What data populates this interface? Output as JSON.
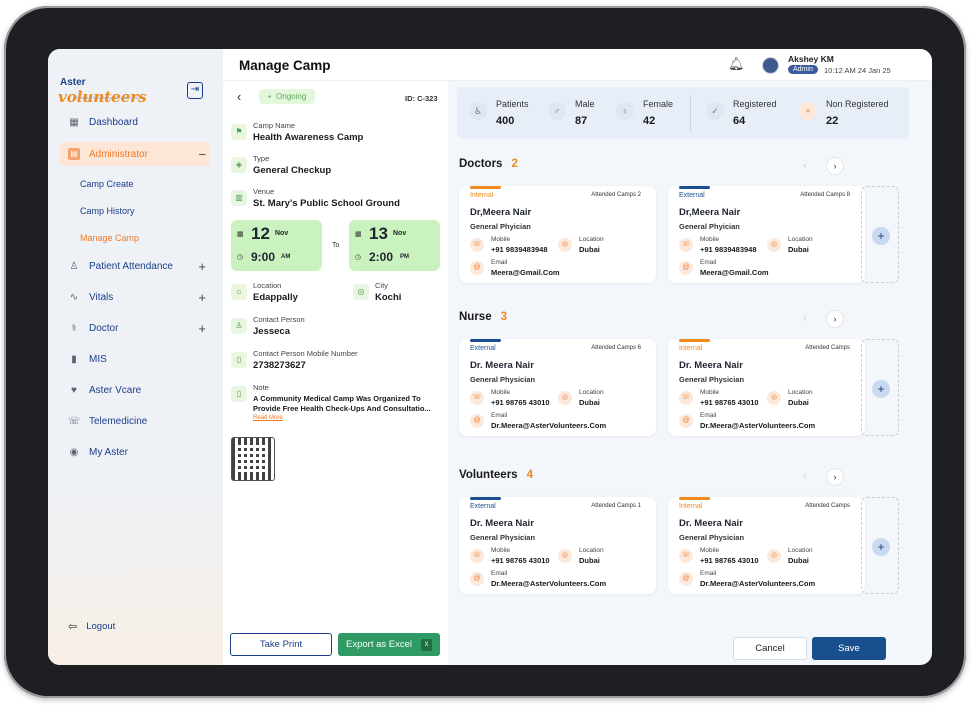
{
  "sidebar": {
    "logo_top": "Aster",
    "logo_main": "volunteers",
    "logo_tag": "Mobilising Volunteers for Community",
    "items": [
      {
        "label": "Dashboard",
        "icon": "grid-icon"
      },
      {
        "label": "Administrator",
        "icon": "admin-icon",
        "expanded": true
      },
      {
        "label": "Patient Attendance",
        "icon": "person-icon"
      },
      {
        "label": "Vitals",
        "icon": "pulse-icon"
      },
      {
        "label": "Doctor",
        "icon": "doctor-icon"
      },
      {
        "label": "MIS",
        "icon": "file-icon"
      },
      {
        "label": "Aster Vcare",
        "icon": "heart-icon"
      },
      {
        "label": "Telemedicine",
        "icon": "phone-icon"
      },
      {
        "label": "My Aster",
        "icon": "user-circle-icon"
      }
    ],
    "sub_items": [
      "Camp Create",
      "Camp History",
      "Manage Camp"
    ],
    "logout": "Logout"
  },
  "header": {
    "title": "Manage Camp",
    "user_name": "Akshey KM",
    "role": "Admin",
    "datetime": "10:12 AM 24 Jan 25"
  },
  "detail": {
    "status": "Ongoing",
    "camp_id": "ID: C-323",
    "camp_name_label": "Camp Name",
    "camp_name": "Health Awareness Camp",
    "type_label": "Type",
    "type": "General Checkup",
    "venue_label": "Venue",
    "venue": "St. Mary's Public School Ground",
    "start_day": "12",
    "start_month": "Nov",
    "start_time": "9:00",
    "start_ampm": "AM",
    "to": "To",
    "end_day": "13",
    "end_month": "Nov",
    "end_time": "2:00",
    "end_ampm": "PM",
    "location_label": "Location",
    "location": "Edappally",
    "city_label": "City",
    "city": "Kochi",
    "contact_label": "Contact Person",
    "contact": "Jesseca",
    "mobile_label": "Contact Person Mobile Number",
    "mobile": "2738273627",
    "note_label": "Note",
    "note": "A Community Medical Camp Was Organized To Provide Free Health Check-Ups And Consultatio...",
    "read_more": "Read More",
    "print_btn": "Take Print",
    "excel_btn": "Export as Excel"
  },
  "stats": [
    {
      "label": "Patients",
      "value": "400",
      "icon": "patients-icon"
    },
    {
      "label": "Male",
      "value": "87",
      "icon": "male-icon"
    },
    {
      "label": "Female",
      "value": "42",
      "icon": "female-icon"
    },
    {
      "label": "Registered",
      "value": "64",
      "icon": "registered-icon"
    },
    {
      "label": "Non Registered",
      "value": "22",
      "icon": "non-registered-icon"
    }
  ],
  "sections": [
    {
      "title": "Doctors",
      "count": "2",
      "cards": [
        {
          "type": "Internal",
          "attended": "Attended Camps 2",
          "name": "Dr,Meera Nair",
          "spec": "General Phyician",
          "mobile_label": "Mobile",
          "mobile": "+91 9839483948",
          "location_label": "Location",
          "location": "Dubai",
          "email_label": "Email",
          "email": "Meera@Gmail.Com"
        },
        {
          "type": "External",
          "attended": "Attended Camps 8",
          "name": "Dr,Meera Nair",
          "spec": "General Phyician",
          "mobile_label": "Mobile",
          "mobile": "+91 9839483948",
          "location_label": "Location",
          "location": "Dubai",
          "email_label": "Email",
          "email": "Meera@Gmail.Com"
        }
      ]
    },
    {
      "title": "Nurse",
      "count": "3",
      "cards": [
        {
          "type": "External",
          "attended": "Attended Camps 6",
          "name": "Dr. Meera Nair",
          "spec": "General Physician",
          "mobile_label": "Mobile",
          "mobile": "+91 98765 43010",
          "location_label": "Location",
          "location": "Dubai",
          "email_label": "Email",
          "email": "Dr.Meera@AsterVolunteers.Com"
        },
        {
          "type": "Internal",
          "attended": "Attended Camps",
          "name": "Dr. Meera Nair",
          "spec": "General Physician",
          "mobile_label": "Mobile",
          "mobile": "+91 98765 43010",
          "location_label": "Location",
          "location": "Dubai",
          "email_label": "Email",
          "email": "Dr.Meera@AsterVolunteers.Com"
        }
      ]
    },
    {
      "title": "Volunteers",
      "count": "4",
      "cards": [
        {
          "type": "External",
          "attended": "Attended Camps 1",
          "name": "Dr. Meera Nair",
          "spec": "General Physician",
          "mobile_label": "Mobile",
          "mobile": "+91 98765 43010",
          "location_label": "Location",
          "location": "Dubai",
          "email_label": "Email",
          "email": "Dr.Meera@AsterVolunteers.Com"
        },
        {
          "type": "Internal",
          "attended": "Attended Camps",
          "name": "Dr. Meera Nair",
          "spec": "General Physician",
          "mobile_label": "Mobile",
          "mobile": "+91 98765 43010",
          "location_label": "Location",
          "location": "Dubai",
          "email_label": "Email",
          "email": "Dr.Meera@AsterVolunteers.Com"
        }
      ]
    }
  ],
  "footer": {
    "cancel": "Cancel",
    "save": "Save"
  },
  "colors": {
    "internal": "#f08a1c",
    "external": "#1a4f8f",
    "accent": "#f07a2a",
    "brand": "#1a3f8a"
  }
}
